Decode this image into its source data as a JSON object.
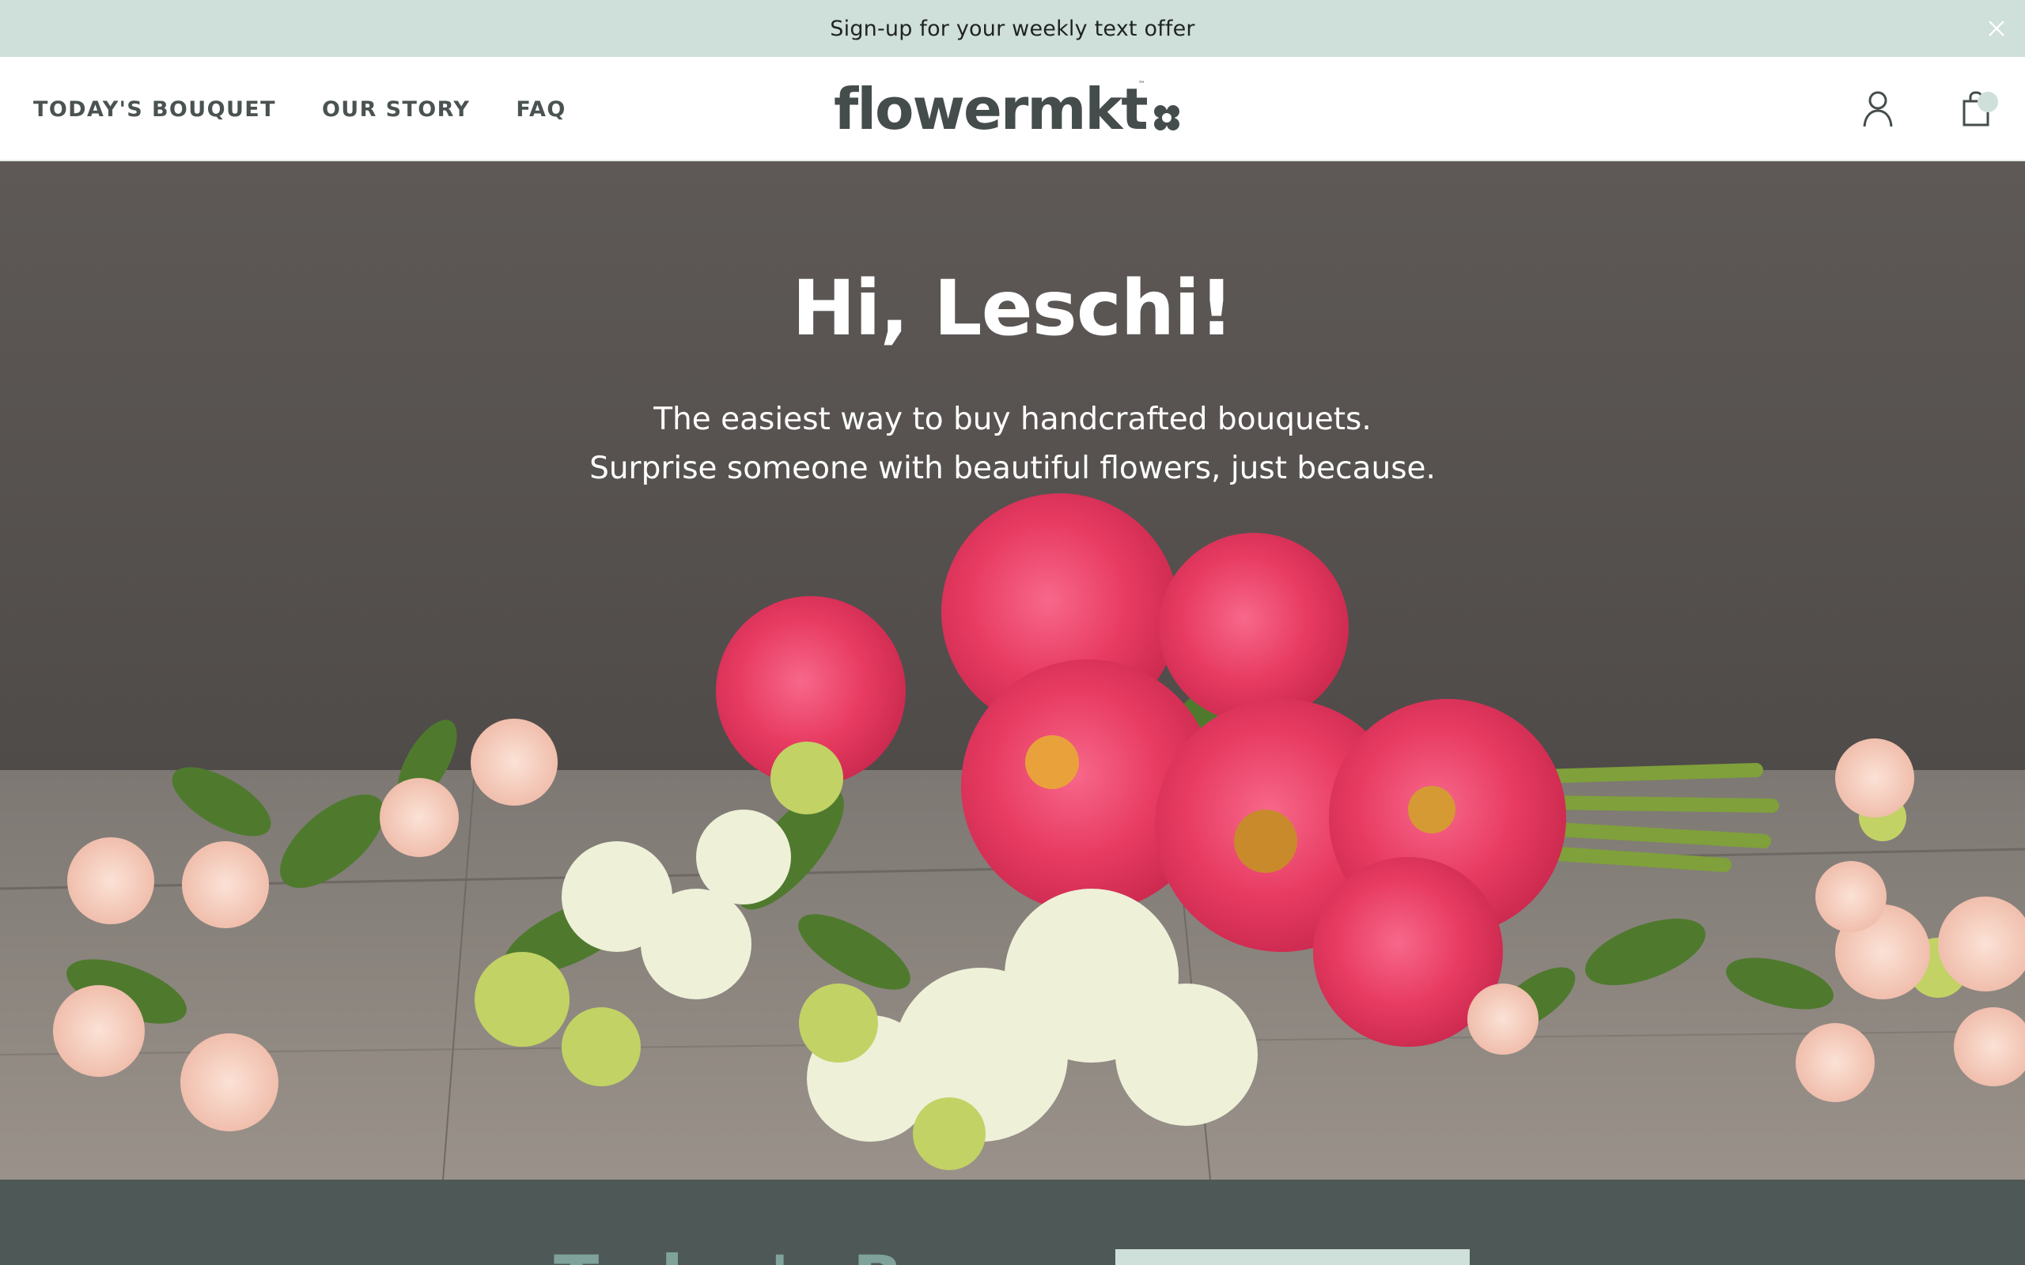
{
  "announcement": {
    "text": "Sign-up for your weekly text offer",
    "close_icon": "close-icon"
  },
  "nav": {
    "items": [
      {
        "label": "TODAY'S BOUQUET"
      },
      {
        "label": "OUR STORY"
      },
      {
        "label": "FAQ"
      }
    ]
  },
  "logo": {
    "text": "flowermkt",
    "tm": "™",
    "mark_icon": "flower-logo-icon"
  },
  "header_icons": {
    "account": "account-icon",
    "cart": "shopping-bag-icon"
  },
  "hero": {
    "title": "Hi, Leschi!",
    "subtitle_line1": "The easiest way to buy handcrafted bouquets.",
    "subtitle_line2": "Surprise someone with beautiful flowers, just because."
  },
  "section": {
    "title": "Today's Bouquet"
  },
  "colors": {
    "announcement_bg": "#cfdfd9",
    "text_dark": "#454d4c",
    "band_bg": "#4e5857",
    "accent": "#cfdfd9"
  }
}
